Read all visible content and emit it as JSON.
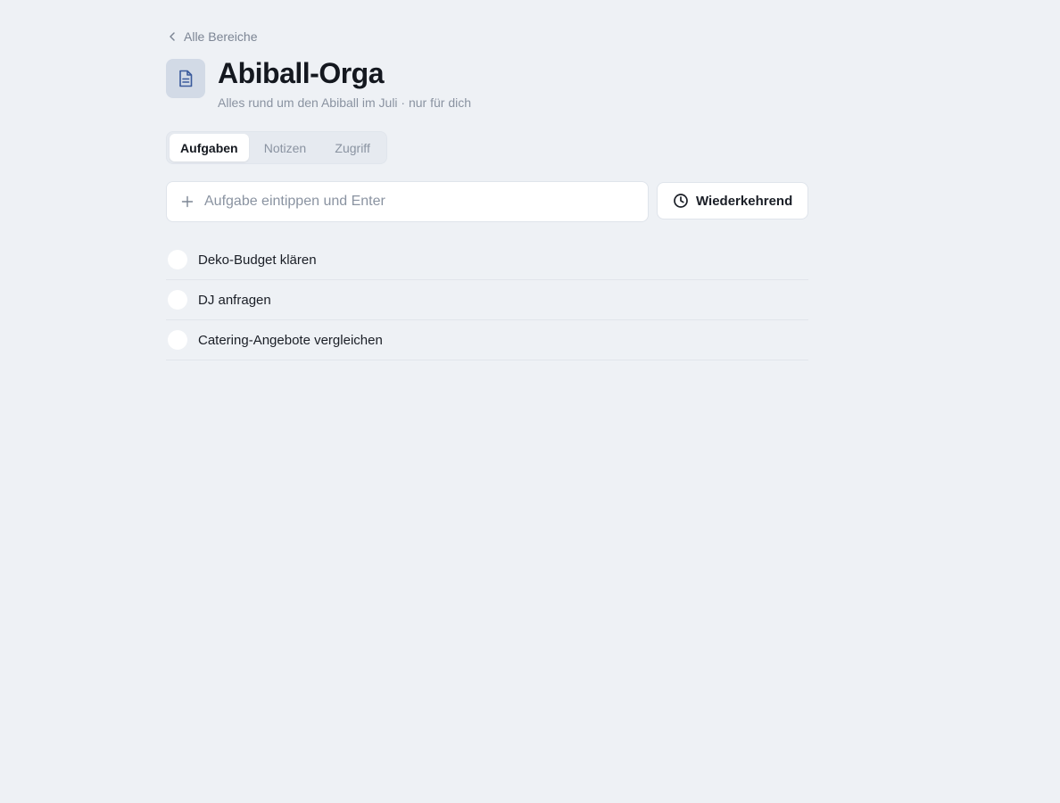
{
  "nav": {
    "back_label": "Alle Bereiche"
  },
  "header": {
    "icon": "document-icon",
    "title": "Abiball-Orga",
    "subtitle": "Alles rund um den Abiball im Juli · nur für dich"
  },
  "tabs": [
    {
      "label": "Aufgaben",
      "active": true
    },
    {
      "label": "Notizen",
      "active": false
    },
    {
      "label": "Zugriff",
      "active": false
    }
  ],
  "task_input": {
    "placeholder": "Aufgabe eintippen und Enter",
    "value": ""
  },
  "recurring_button": {
    "label": "Wiederkehrend",
    "icon": "clock-icon"
  },
  "tasks": [
    {
      "label": "Deko-Budget klären",
      "done": false
    },
    {
      "label": "DJ anfragen",
      "done": false
    },
    {
      "label": "Catering-Angebote vergleichen",
      "done": false
    }
  ],
  "colors": {
    "background": "#eef1f5",
    "accent_icon": "#3a5a9c",
    "muted_text": "#8a93a1"
  }
}
